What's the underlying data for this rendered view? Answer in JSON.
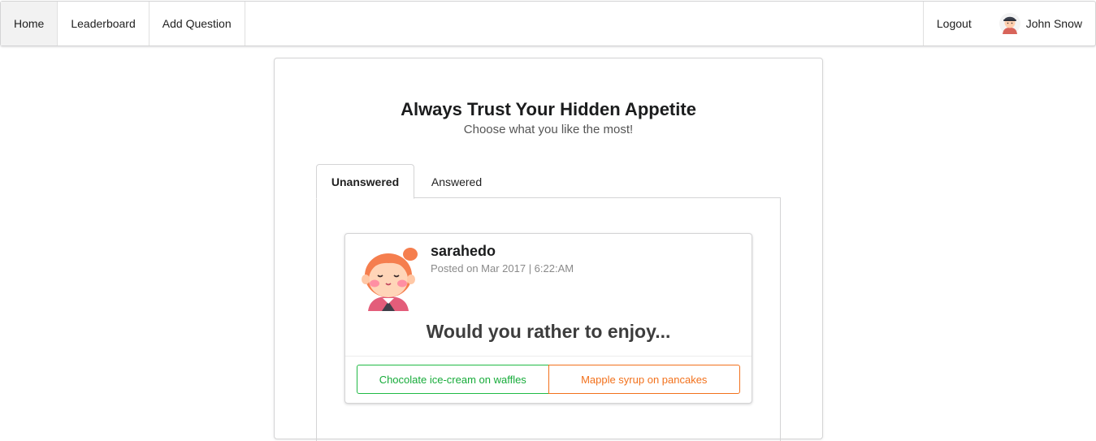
{
  "nav": {
    "items": [
      {
        "label": "Home",
        "active": true
      },
      {
        "label": "Leaderboard",
        "active": false
      },
      {
        "label": "Add Question",
        "active": false
      }
    ],
    "logout_label": "Logout",
    "user_name": "John Snow"
  },
  "page": {
    "title": "Always Trust Your Hidden Appetite",
    "subtitle": "Choose what you like the most!"
  },
  "tabs": [
    {
      "label": "Unanswered",
      "active": true
    },
    {
      "label": "Answered",
      "active": false
    }
  ],
  "question": {
    "author": "sarahedo",
    "posted": "Posted on Mar 2017 | 6:22:AM",
    "prompt": "Would you rather to enjoy...",
    "option_one": "Chocolate ice-cream on waffles",
    "option_two": "Mapple syrup on pancakes"
  },
  "colors": {
    "option_one": "#21ba45",
    "option_two": "#f2711c",
    "avatar_hair": "#f57e4e",
    "avatar_skin": "#ffd5b8"
  },
  "icons": {
    "user_avatar": "male-avatar-icon",
    "author_avatar": "female-avatar-icon"
  }
}
